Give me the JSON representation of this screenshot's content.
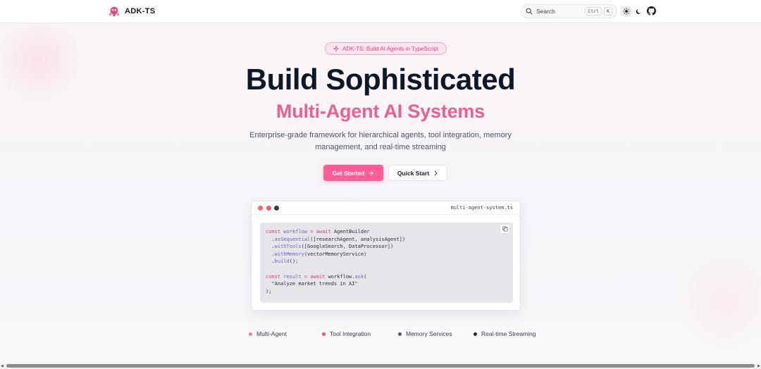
{
  "nav": {
    "logo_text": "ADK-TS",
    "search_label": "Search",
    "kbd_ctrl": "Ctrl",
    "kbd_k": "K"
  },
  "hero": {
    "badge": "ADK-TS: Build AI Agents in TypeScript",
    "title": "Build Sophisticated",
    "subtitle": "Multi-Agent AI Systems",
    "desc_line1": "Enterprise-grade framework for hierarchical agents, tool integration, memory",
    "desc_line2": "management, and real-time streaming",
    "primary_button": "Get Started",
    "secondary_button": "Quick Start"
  },
  "code": {
    "filename": "multi-agent-system.ts",
    "lines": [
      [
        [
          "kw",
          "const "
        ],
        [
          "var",
          "workflow"
        ],
        [
          "kw",
          " = await "
        ],
        [
          "str",
          "AgentBuilder"
        ]
      ],
      [
        [
          "str",
          "  ."
        ],
        [
          "fn",
          "asSequential"
        ],
        [
          "str",
          "([researchAgent, analysisAgent])"
        ]
      ],
      [
        [
          "str",
          "  ."
        ],
        [
          "fn",
          "withTools"
        ],
        [
          "str",
          "([GoogleSearch, DataProcessor])"
        ]
      ],
      [
        [
          "str",
          "  ."
        ],
        [
          "fn",
          "withMemory"
        ],
        [
          "str",
          "(vectorMemoryService)"
        ]
      ],
      [
        [
          "str",
          "  ."
        ],
        [
          "fn",
          "build"
        ],
        [
          "str",
          "();"
        ]
      ],
      [],
      [
        [
          "kw",
          "const "
        ],
        [
          "var",
          "result"
        ],
        [
          "kw",
          " = await "
        ],
        [
          "str",
          "workflow."
        ],
        [
          "fn",
          "ask"
        ],
        [
          "str",
          "("
        ]
      ],
      [
        [
          "str",
          "  \"Analyze market trends in AI\""
        ]
      ],
      [
        [
          "str",
          ");"
        ]
      ]
    ]
  },
  "features": [
    {
      "label": "Multi-Agent",
      "color": "#f07c9e"
    },
    {
      "label": "Tool Integration",
      "color": "#f0506e"
    },
    {
      "label": "Memory Services",
      "color": "#4b5563"
    },
    {
      "label": "Real-time Streaming",
      "color": "#1f2937"
    }
  ],
  "colors": {
    "accent": "#ff5d95",
    "dot_red": "#f06a6a",
    "dot_pink": "#f05a7a",
    "dot_dark": "#3a3a40"
  }
}
